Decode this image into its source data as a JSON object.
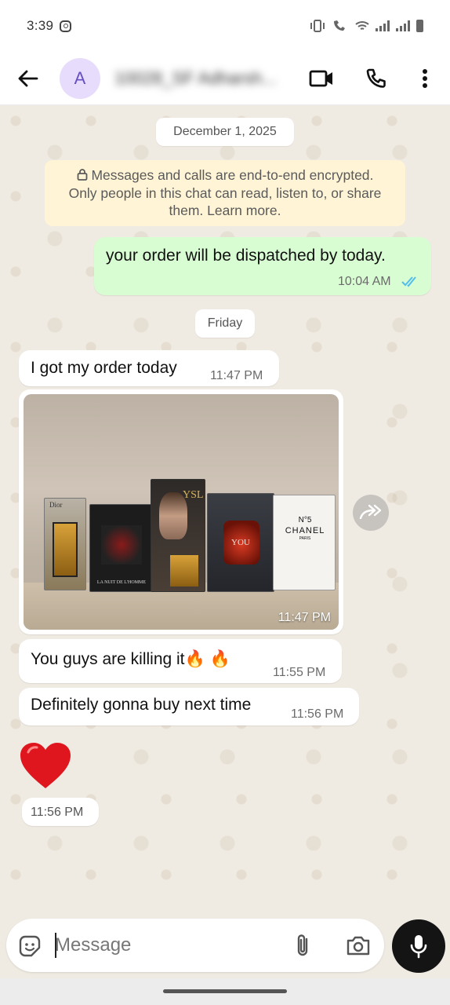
{
  "status_bar": {
    "time": "3:39"
  },
  "header": {
    "avatar_letter": "A",
    "contact_name": "10028_SF Adharsh...",
    "icons": [
      "back-arrow-icon",
      "video-call-icon",
      "phone-icon",
      "more-vert-icon"
    ]
  },
  "chat": {
    "date_1": "December 1, 2025",
    "encryption_notice_lines": [
      "Messages and calls are end-to-end encrypted.",
      "Only people in this chat can read, listen to, or share",
      "them. Learn more."
    ],
    "msg_out_1": {
      "text": "your order will be dispatched by today.",
      "time": "10:04 AM",
      "status": "read"
    },
    "date_2": "Friday",
    "msg_in_1": {
      "text": "I got my order today",
      "time": "11:47 PM"
    },
    "msg_in_photo": {
      "time": "11:47 PM",
      "box_labels": [
        "Dior",
        "LA NUIT DE L'HOMME",
        "YSL",
        "YOU",
        "CHANEL"
      ],
      "chanel_lines": [
        "N°5",
        "CHANEL",
        "PARIS"
      ]
    },
    "msg_in_2": {
      "text": "You guys are killing it🔥 🔥",
      "time": "11:55 PM"
    },
    "msg_in_3": {
      "text": "Definitely gonna buy next time",
      "time": "11:56 PM"
    },
    "msg_in_heart": {
      "emoji": "❤",
      "time": "11:56 PM"
    }
  },
  "input": {
    "placeholder": "Message"
  },
  "colors": {
    "chat_bg": "#efeae2",
    "outgoing_bubble": "#d9fdd3",
    "incoming_bubble": "#ffffff",
    "read_tick": "#53bdeb",
    "encryption_bg": "#fff4d6"
  }
}
